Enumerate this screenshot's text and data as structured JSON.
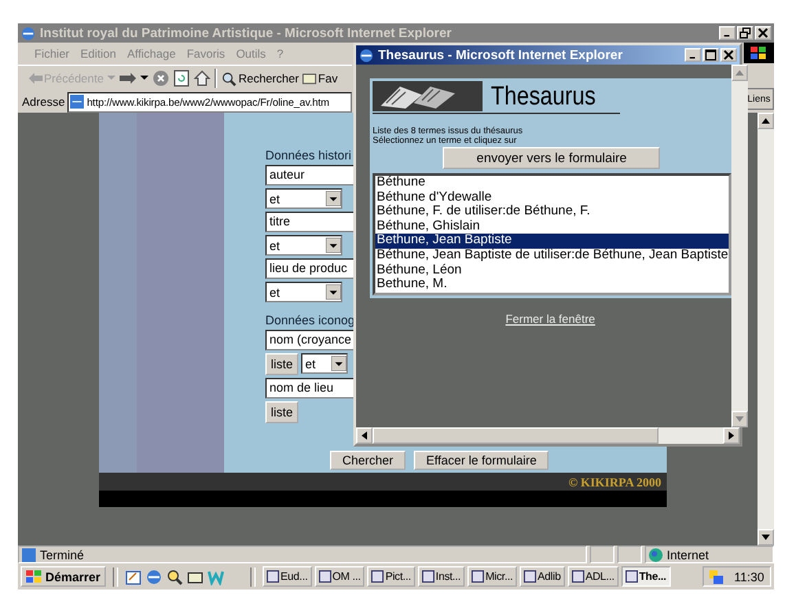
{
  "main_window": {
    "title": "Institut royal du Patrimoine Artistique - Microsoft Internet Explorer",
    "menu": [
      "Fichier",
      "Edition",
      "Affichage",
      "Favoris",
      "Outils",
      "?"
    ],
    "toolbar": {
      "back": {
        "label": "Précédente",
        "disabled": true
      },
      "search": "Rechercher",
      "favorites": "Fav"
    },
    "address": {
      "label": "Adresse",
      "value": "http://www.kikirpa.be/www2/wwwopac/Fr/oline_av.htm"
    },
    "links": "Liens",
    "page": {
      "sections": [
        {
          "heading": "Données histori",
          "fields": [
            {
              "kind": "input",
              "value": "auteur"
            },
            {
              "kind": "select",
              "value": "et"
            },
            {
              "kind": "input",
              "value": "titre"
            },
            {
              "kind": "select",
              "value": "et"
            },
            {
              "kind": "input",
              "value": "lieu de produc"
            },
            {
              "kind": "select",
              "value": "et"
            }
          ]
        },
        {
          "heading": "Données iconog",
          "fields": [
            {
              "kind": "input",
              "value": "nom (croyance"
            },
            {
              "kind": "row",
              "items": [
                {
                  "kind": "button",
                  "value": "liste"
                },
                {
                  "kind": "select",
                  "value": "et"
                }
              ]
            },
            {
              "kind": "input",
              "value": "nom de lieu"
            },
            {
              "kind": "button",
              "value": "liste"
            }
          ]
        }
      ],
      "buttons": [
        "Chercher",
        "Effacer le formulaire"
      ],
      "copyright": "© KIKIRPA 2000"
    },
    "status_bar": {
      "text": "Terminé",
      "zone": "Internet"
    }
  },
  "popup": {
    "title": "Thesaurus - Microsoft Internet Explorer",
    "heading": "Thesaurus",
    "instructions": [
      "Liste des 8 termes issus du thésaurus",
      "Sélectionnez un terme et cliquez sur"
    ],
    "send_button": "envoyer vers le formulaire",
    "terms": [
      {
        "label": "Béthune",
        "selected": false
      },
      {
        "label": "Béthune d'Ydewalle",
        "selected": false
      },
      {
        "label": "Béthune, F. de utiliser:de Béthune, F.",
        "selected": false
      },
      {
        "label": "Béthune, Ghislain",
        "selected": false
      },
      {
        "label": "Bethune, Jean Baptiste",
        "selected": true
      },
      {
        "label": "Béthune, Jean Baptiste de utiliser:de Béthune, Jean Baptiste",
        "selected": false
      },
      {
        "label": "Béthune, Léon",
        "selected": false
      },
      {
        "label": "Bethune, M.",
        "selected": false
      }
    ],
    "close_link": "Fermer la fenêtre"
  },
  "taskbar": {
    "start": "Démarrer",
    "tasks": [
      {
        "label": "Eud...",
        "selected": false
      },
      {
        "label": "OM ...",
        "selected": false
      },
      {
        "label": "Pict...",
        "selected": false
      },
      {
        "label": "Inst...",
        "selected": false
      },
      {
        "label": "Micr...",
        "selected": false
      },
      {
        "label": "Adlib",
        "selected": false
      },
      {
        "label": "ADL...",
        "selected": false
      },
      {
        "label": "The...",
        "selected": true
      }
    ],
    "clock": "11:30"
  }
}
